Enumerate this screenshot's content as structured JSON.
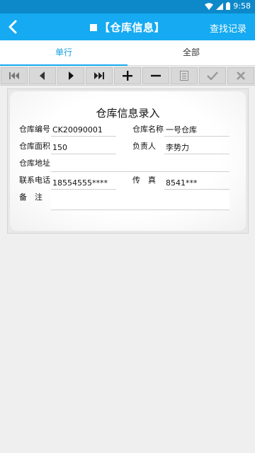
{
  "status": {
    "time": "9:58",
    "icons": [
      "wifi-icon",
      "signal-icon",
      "battery-icon"
    ]
  },
  "appbar": {
    "title": "【仓库信息】",
    "find_label": "查找记录",
    "back_icon": "back-arrow-icon"
  },
  "tabs": [
    {
      "label": "单行",
      "active": true
    },
    {
      "label": "全部",
      "active": false
    }
  ],
  "toolbar": {
    "buttons": [
      "first-record-icon",
      "previous-record-icon",
      "next-record-icon",
      "last-record-icon",
      "add-icon",
      "remove-icon",
      "document-icon",
      "confirm-check-icon",
      "cancel-x-icon"
    ]
  },
  "form": {
    "title": "仓库信息录入",
    "labels": {
      "code": "仓库编号",
      "name": "仓库名称",
      "area": "仓库面积",
      "manager": "负责人",
      "address": "仓库地址",
      "phone": "联系电话",
      "fax": "传　真",
      "note": "备　注"
    },
    "values": {
      "code": "CK20090001",
      "name": "一号仓库",
      "area": "150",
      "manager": "李势力",
      "address": "",
      "phone": "18554555****",
      "fax": "8541***",
      "note": ""
    }
  },
  "colors": {
    "statusbar": "#0d89c9",
    "appbar": "#15aaf1",
    "tab_active": "#15a0e0"
  }
}
